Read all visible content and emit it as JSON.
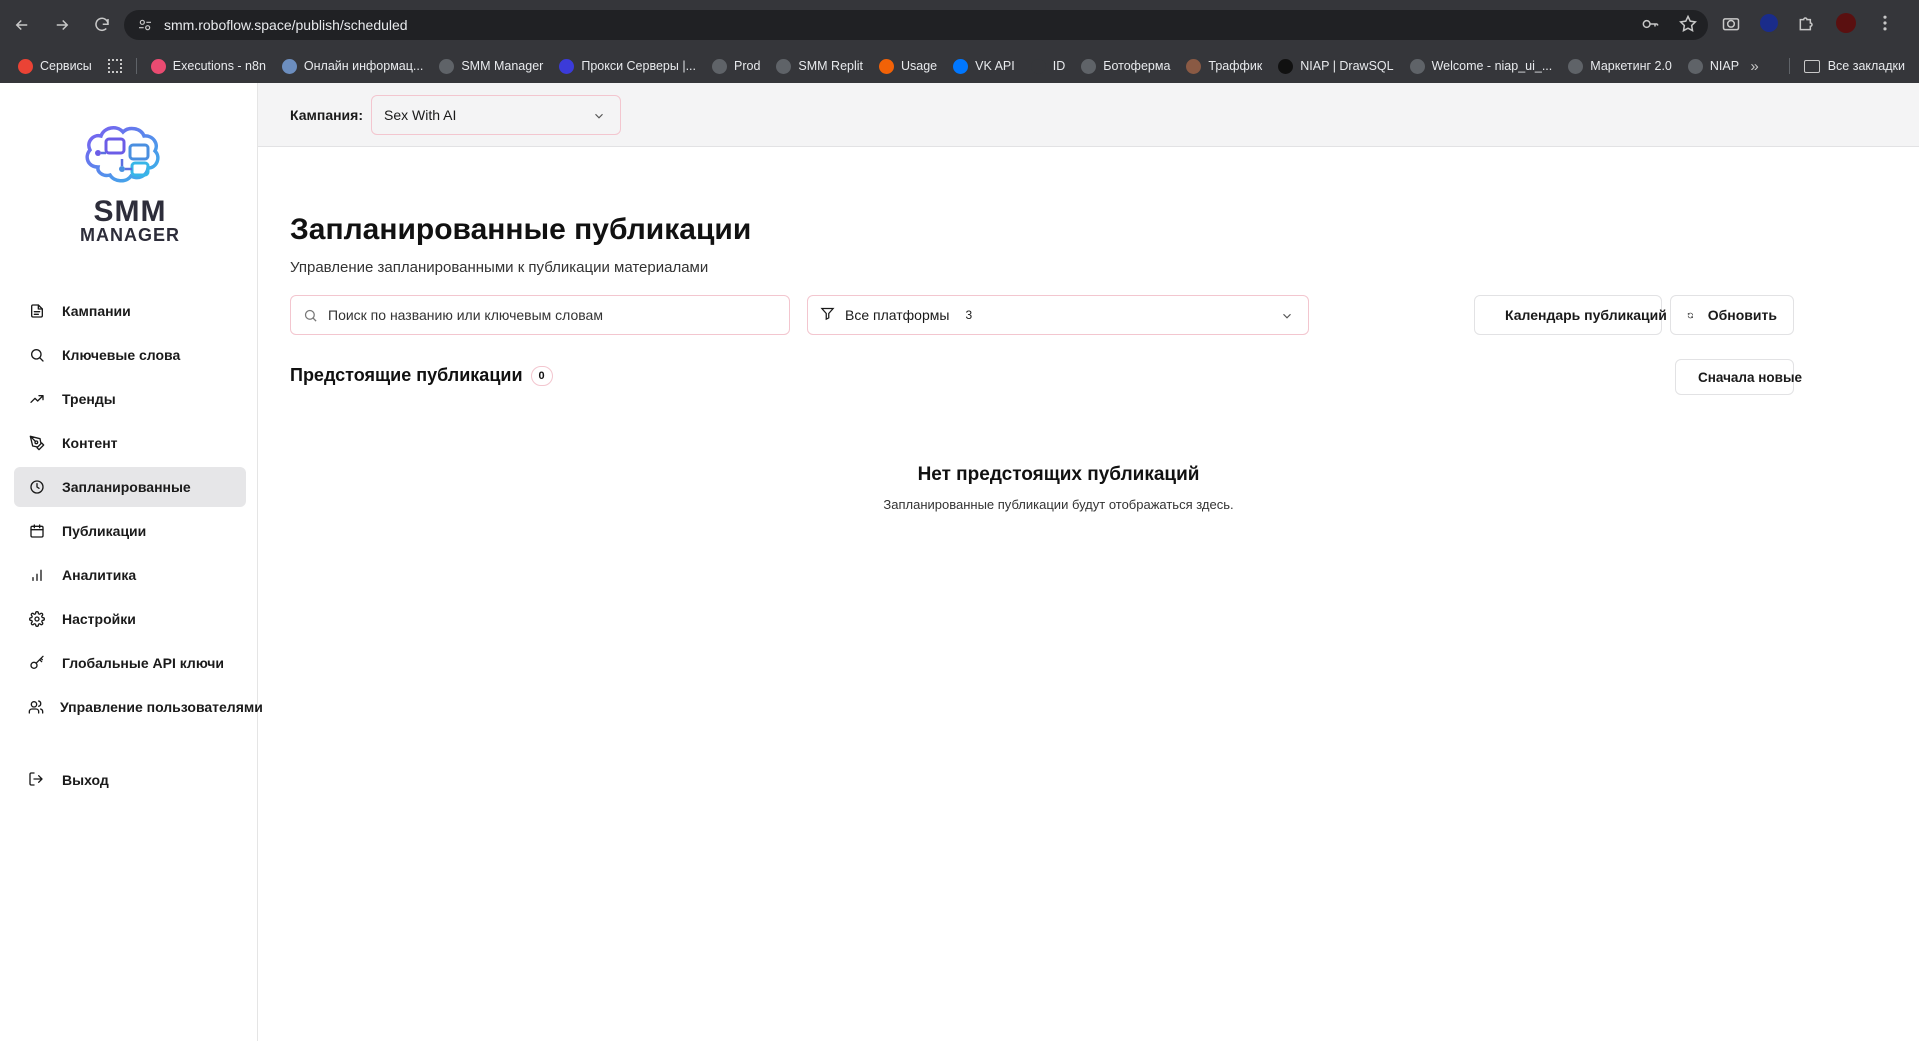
{
  "browser": {
    "url": "smm.roboflow.space/publish/scheduled",
    "bookmarks": [
      {
        "label": "Сервисы",
        "icon": "apps-grid-icon",
        "color": "#ea4335"
      },
      {
        "label": "Executions - n8n",
        "icon": "n8n-icon",
        "color": "#ea4b71"
      },
      {
        "label": "Онлайн информац...",
        "icon": "v-logo-icon",
        "color": "#6c8ebf"
      },
      {
        "label": "SMM Manager",
        "icon": "globe-icon",
        "color": "#5f6368"
      },
      {
        "label": "Прокси Серверы |...",
        "icon": "proxy-icon",
        "color": "#3b3bd9"
      },
      {
        "label": "Prod",
        "icon": "globe-icon",
        "color": "#5f6368"
      },
      {
        "label": "SMM Replit",
        "icon": "globe-icon",
        "color": "#5f6368"
      },
      {
        "label": "Usage",
        "icon": "replit-icon",
        "color": "#f26207"
      },
      {
        "label": "VK API",
        "icon": "vk-icon",
        "color": "#0077ff"
      },
      {
        "label": "ID",
        "icon": "r-logo-icon",
        "color": "#35363a"
      },
      {
        "label": "Ботоферма",
        "icon": "globe-icon",
        "color": "#5f6368"
      },
      {
        "label": "Траффик",
        "icon": "avatar-icon",
        "color": "#8a5a44"
      },
      {
        "label": "NIAP | DrawSQL",
        "icon": "drawsql-icon",
        "color": "#111111"
      },
      {
        "label": "Welcome - niap_ui_...",
        "icon": "github-icon",
        "color": "#5f6368"
      },
      {
        "label": "Маркетинг 2.0",
        "icon": "globe-icon",
        "color": "#5f6368"
      },
      {
        "label": "NIAP",
        "icon": "globe-icon",
        "color": "#5f6368"
      }
    ],
    "all_bookmarks": "Все закладки"
  },
  "logo": {
    "line1": "SMM",
    "line2": "MANAGER"
  },
  "sidebar": {
    "items": [
      {
        "label": "Кампании",
        "icon": "file-icon"
      },
      {
        "label": "Ключевые слова",
        "icon": "search-icon"
      },
      {
        "label": "Тренды",
        "icon": "trending-up-icon"
      },
      {
        "label": "Контент",
        "icon": "pen-tool-icon"
      },
      {
        "label": "Запланированные",
        "icon": "clock-icon",
        "active": true
      },
      {
        "label": "Публикации",
        "icon": "calendar-icon"
      },
      {
        "label": "Аналитика",
        "icon": "bar-chart-icon"
      },
      {
        "label": "Настройки",
        "icon": "gear-icon"
      },
      {
        "label": "Глобальные API ключи",
        "icon": "key-icon"
      },
      {
        "label": "Управление пользователями",
        "icon": "users-icon"
      }
    ],
    "logout": "Выход"
  },
  "topbar": {
    "campaign_label": "Кампания:",
    "campaign_value": "Sex With AI"
  },
  "page": {
    "title": "Запланированные публикации",
    "subtitle": "Управление запланированными к публикации материалами",
    "search_placeholder": "Поиск по названию или ключевым словам",
    "platform_filter": "Все платформы",
    "platform_count": "3",
    "calendar_button": "Календарь публикаций",
    "refresh_button": "Обновить",
    "section_title": "Предстоящие публикации",
    "section_count": "0",
    "sort_button": "Сначала новые",
    "empty_title": "Нет предстоящих публикаций",
    "empty_subtitle": "Запланированные публикации будут отображаться здесь."
  }
}
